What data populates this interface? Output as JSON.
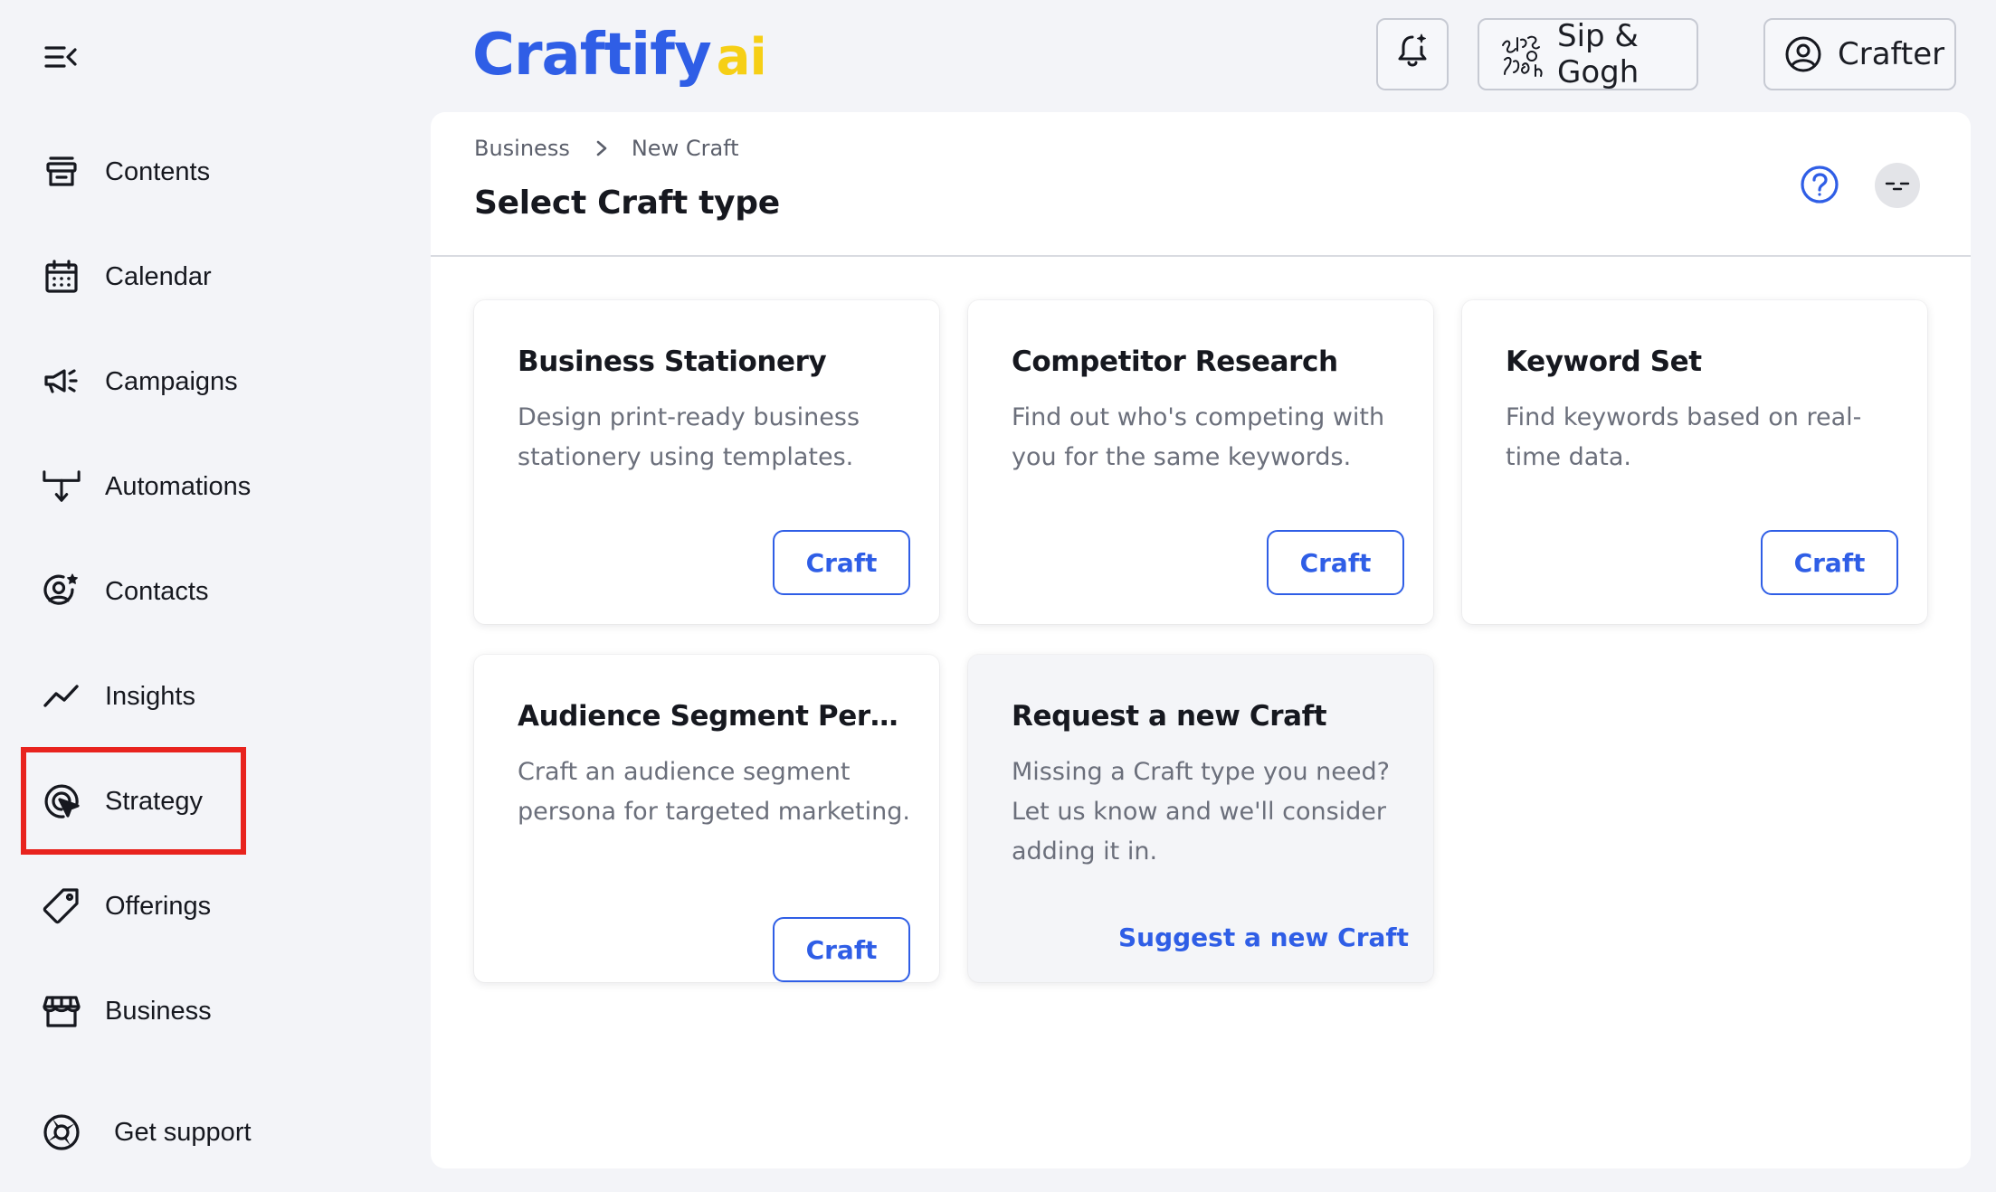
{
  "sidebar": {
    "items": [
      {
        "label": "Contents",
        "icon": "archive-icon"
      },
      {
        "label": "Calendar",
        "icon": "calendar-icon"
      },
      {
        "label": "Campaigns",
        "icon": "megaphone-icon"
      },
      {
        "label": "Automations",
        "icon": "flow-icon"
      },
      {
        "label": "Contacts",
        "icon": "user-star-icon"
      },
      {
        "label": "Insights",
        "icon": "trend-icon"
      },
      {
        "label": "Strategy",
        "icon": "target-cursor-icon",
        "highlighted": true
      },
      {
        "label": "Offerings",
        "icon": "tag-icon"
      },
      {
        "label": "Business",
        "icon": "store-icon"
      }
    ],
    "support_label": "Get support",
    "highlight_color": "#e8231e"
  },
  "header": {
    "logo_main": "Craftify",
    "logo_ai": "ai",
    "org_name": "Sip & Gogh",
    "user_label": "Crafter"
  },
  "main": {
    "breadcrumb": [
      "Business",
      "New Craft"
    ],
    "title": "Select Craft type",
    "cards": [
      {
        "title": "Business Stationery",
        "description": "Design print-ready business stationery using templates.",
        "button": "Craft"
      },
      {
        "title": "Competitor Research",
        "description": "Find out who's competing with you for the same keywords.",
        "button": "Craft"
      },
      {
        "title": "Keyword Set",
        "description": "Find keywords based on real-time data.",
        "button": "Craft"
      },
      {
        "title": "Audience Segment Persona",
        "description": "Craft an audience segment persona for targeted marketing.",
        "button": "Craft"
      }
    ],
    "request_card": {
      "title": "Request a new Craft",
      "description": "Missing a Craft type you need? Let us know and we'll consider adding it in.",
      "link": "Suggest a new Craft"
    }
  },
  "colors": {
    "accent": "#2f5ee6",
    "logo_ai": "#f6cf16",
    "background": "#f3f4f8"
  }
}
